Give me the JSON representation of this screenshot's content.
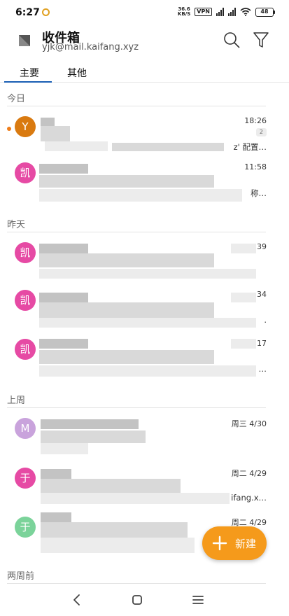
{
  "status_bar": {
    "time": "6:27",
    "net_speed_value": "36.6",
    "net_speed_unit": "KB/S",
    "vpn": "VPN",
    "battery": "48"
  },
  "header": {
    "title": "收件箱",
    "account": "yjk@mail.kaifang.xyz"
  },
  "tabs": [
    {
      "label": "主要",
      "active": true
    },
    {
      "label": "其他",
      "active": false
    }
  ],
  "sections": {
    "today": "今日",
    "yesterday": "昨天",
    "last_week": "上周",
    "two_weeks": "两周前"
  },
  "emails": [
    {
      "avatar": "Y",
      "avatar_color": "#d97a10",
      "time": "18:26",
      "count": "2",
      "preview": "z' 配置…",
      "unread": true
    },
    {
      "avatar": "凯",
      "avatar_color": "#e64aa4",
      "time": "11:58",
      "preview": "称…"
    },
    {
      "avatar": "凯",
      "avatar_color": "#e64aa4",
      "time": ":39",
      "preview": ""
    },
    {
      "avatar": "凯",
      "avatar_color": "#e64aa4",
      "time": ":34",
      "preview": "."
    },
    {
      "avatar": "凯",
      "avatar_color": "#e64aa4",
      "time": ":17",
      "preview": "…"
    },
    {
      "avatar": "M",
      "avatar_color": "#c9a3dc",
      "time": "周三 4/30",
      "preview": ""
    },
    {
      "avatar": "于",
      "avatar_color": "#e64aa4",
      "time": "周二 4/29",
      "preview": "ifang.x…"
    },
    {
      "avatar": "于",
      "avatar_color": "#7bd39a",
      "time": "周二 4/29",
      "preview": ""
    }
  ],
  "fab": {
    "label": "新建"
  }
}
